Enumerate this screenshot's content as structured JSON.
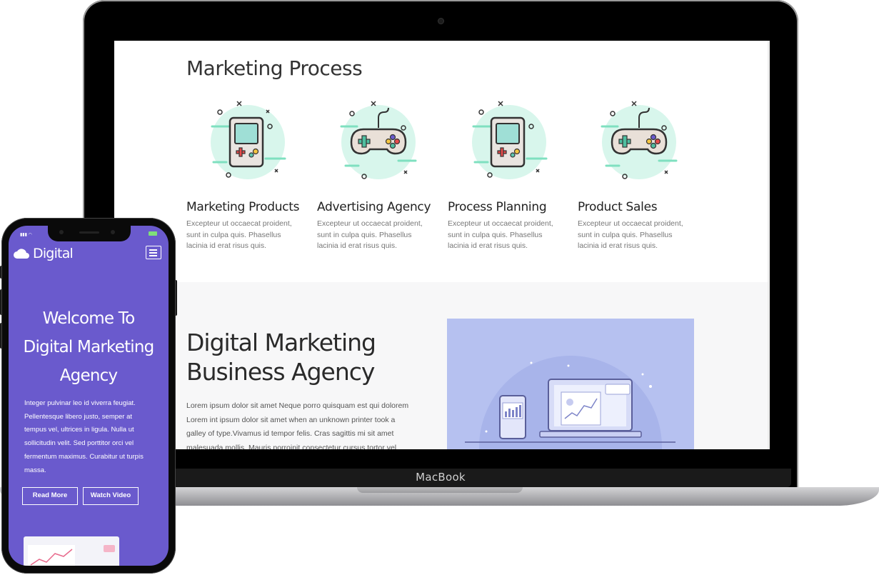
{
  "laptop": {
    "brand": "MacBook"
  },
  "screen": {
    "section_title": "Marketing Process",
    "cards": [
      {
        "title": "Marketing Products",
        "text": "Excepteur ut occaecat proident, sunt in culpa quis. Phasellus lacinia id erat risus quis.",
        "icon": "handheld-game-icon"
      },
      {
        "title": "Advertising Agency",
        "text": "Excepteur ut occaecat proident, sunt in culpa quis. Phasellus lacinia id erat risus quis.",
        "icon": "gamepad-icon"
      },
      {
        "title": "Process Planning",
        "text": "Excepteur ut occaecat proident, sunt in culpa quis. Phasellus lacinia id erat risus quis.",
        "icon": "handheld-game-icon"
      },
      {
        "title": "Product Sales",
        "text": "Excepteur ut occaecat proident, sunt in culpa quis. Phasellus lacinia id erat risus quis.",
        "icon": "gamepad-icon"
      }
    ],
    "agency": {
      "title": "Digital Marketing Business Agency",
      "text": "Lorem ipsum dolor sit amet Neque porro quisquam est qui dolorem Lorem int ipsum dolor sit amet when an unknown printer took a galley of type.Vivamus id tempor felis. Cras sagittis mi sit amet malesuada mollis. Mauris porroinit consectetur cursus tortor vel interdum."
    }
  },
  "phone": {
    "logo": "Digital",
    "headline": "Welcome To Digital Marketing Agency",
    "text": "Integer pulvinar leo id viverra feugiat. Pellentesque libero justo, semper at tempus vel, ultrices in ligula. Nulla ut sollicitudin velit. Sed porttitor orci vel fermentum maximus. Curabitur ut turpis massa.",
    "buttons": {
      "read_more": "Read More",
      "watch_video": "Watch Video"
    }
  },
  "colors": {
    "phone_bg": "#6a5acd",
    "illustration_bg": "#b6c1f0",
    "icon_mint": "#d8f6ec"
  }
}
